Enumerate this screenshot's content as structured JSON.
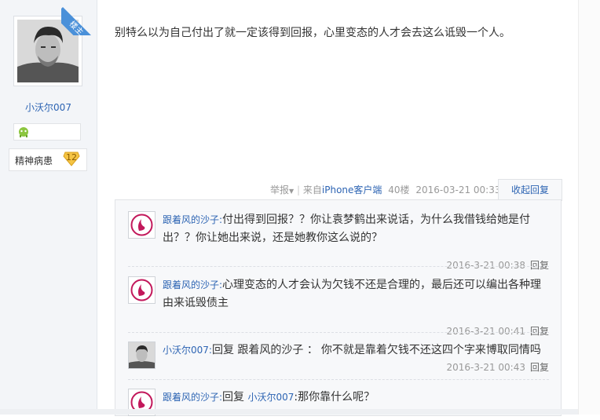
{
  "left": {
    "ribbon": "楼主",
    "username": "小沃尔007",
    "badge_label": "精神病患",
    "badge_level": "12"
  },
  "post": {
    "content": "别特么以为自己付出了就一定该得到回报，心里变态的人才会去这么诋毁一个人。",
    "report": "举报",
    "source_prefix": "来自",
    "source_link": "iPhone客户端",
    "floor": "40楼",
    "time": "2016-03-21 00:33",
    "collapse": "收起回复"
  },
  "replies": [
    {
      "author": "跟着风的沙子:",
      "text": "付出得到回报？？你让袁梦鹤出来说话，为什么我借钱给她是付出？？你让她出来说，还是她教你这么说的？",
      "time": "2016-3-21 00:38",
      "reply": "回复"
    },
    {
      "author": "跟着风的沙子:",
      "text": "心理变态的人才会认为欠钱不还是合理的，最后还可以编出各种理由来诋毁债主",
      "time": "2016-3-21 00:41",
      "reply": "回复"
    },
    {
      "author": "小沃尔007:",
      "prefix": "回复 跟着风的沙子 ：",
      "text": "你不就是靠着欠钱不还这四个字来博取同情吗",
      "time": "2016-3-21 00:43",
      "reply": "回复"
    },
    {
      "author": "跟着风的沙子:",
      "prefix": "回复",
      "mention": "小沃尔007",
      "text": ":那你靠什么呢？"
    }
  ]
}
